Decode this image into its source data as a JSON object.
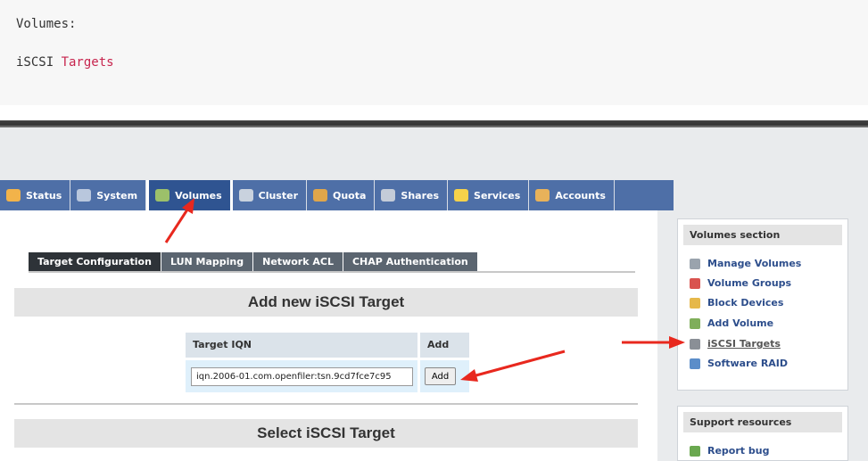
{
  "code_block": {
    "line1": "Volumes:",
    "line2_plain": "iSCSI ",
    "line2_keyword": "Targets"
  },
  "nav": {
    "tabs": [
      {
        "label": "Status",
        "icon": "status-icon",
        "color": "#f2b34a"
      },
      {
        "label": "System",
        "icon": "system-icon",
        "color": "#b9c7dd"
      },
      {
        "label": "Volumes",
        "icon": "volumes-icon",
        "color": "#9cc06a"
      },
      {
        "label": "Cluster",
        "icon": "cluster-icon",
        "color": "#c9d2de"
      },
      {
        "label": "Quota",
        "icon": "quota-icon",
        "color": "#e0a64a"
      },
      {
        "label": "Shares",
        "icon": "shares-icon",
        "color": "#c4ccd8"
      },
      {
        "label": "Services",
        "icon": "services-icon",
        "color": "#f6d24a"
      },
      {
        "label": "Accounts",
        "icon": "accounts-icon",
        "color": "#e8b25a"
      }
    ],
    "active": "Volumes"
  },
  "sub_tabs": {
    "items": [
      "Target Configuration",
      "LUN Mapping",
      "Network ACL",
      "CHAP Authentication"
    ],
    "active": "Target Configuration"
  },
  "add_target": {
    "heading": "Add new iSCSI Target",
    "col_iqn": "Target IQN",
    "col_add": "Add",
    "iqn_value": "iqn.2006-01.com.openfiler:tsn.9cd7fce7c95",
    "add_button": "Add"
  },
  "select_target": {
    "heading": "Select iSCSI Target"
  },
  "sidebar": {
    "volumes_title": "Volumes section",
    "volumes_items": [
      {
        "label": "Manage Volumes",
        "icon": "manage-volumes-icon",
        "color": "#9aa3ad"
      },
      {
        "label": "Volume Groups",
        "icon": "volume-groups-icon",
        "color": "#d9534f"
      },
      {
        "label": "Block Devices",
        "icon": "block-devices-icon",
        "color": "#e6b84a"
      },
      {
        "label": "Add Volume",
        "icon": "add-volume-icon",
        "color": "#7fae5a"
      },
      {
        "label": "iSCSI Targets",
        "icon": "iscsi-targets-icon",
        "color": "#8a8f96"
      },
      {
        "label": "Software RAID",
        "icon": "software-raid-icon",
        "color": "#5b8dc9"
      }
    ],
    "active_item": "iSCSI Targets",
    "support_title": "Support resources",
    "support_items": [
      {
        "label": "Report bug",
        "icon": "report-bug-icon",
        "color": "#6aa84f"
      }
    ]
  },
  "colors": {
    "nav_bg": "#4e6fa7",
    "nav_active": "#2f5491",
    "annotation_arrow": "#e8281e"
  }
}
